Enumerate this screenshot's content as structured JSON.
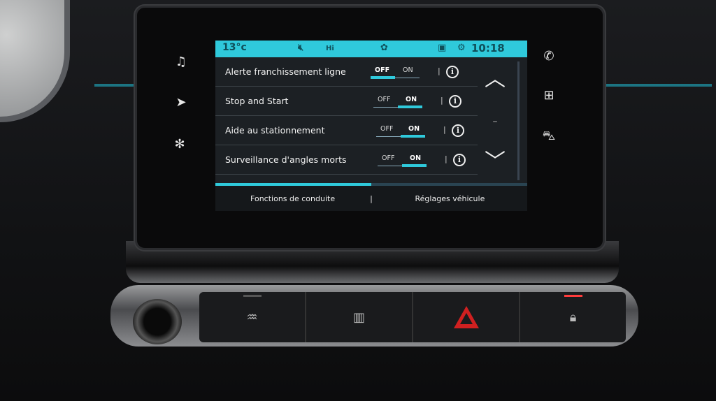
{
  "status_bar": {
    "temperature": "13°c",
    "mute_icon": "speaker-muted-icon",
    "fan_label": "Hi",
    "fan_icon": "fan-icon",
    "screen_icon": "display-icon",
    "settings_icon": "gear-icon",
    "time": "10:18"
  },
  "settings": [
    {
      "label": "Alerte franchissement ligne",
      "off": "OFF",
      "on": "ON",
      "state": "OFF"
    },
    {
      "label": "Stop and Start",
      "off": "OFF",
      "on": "ON",
      "state": "ON"
    },
    {
      "label": "Aide au stationnement",
      "off": "OFF",
      "on": "ON",
      "state": "ON"
    },
    {
      "label": "Surveillance d'angles morts",
      "off": "OFF",
      "on": "ON",
      "state": "ON"
    }
  ],
  "info_glyph": "i",
  "separator": "|",
  "tabs": [
    {
      "label": "Fonctions de conduite",
      "active": true
    },
    {
      "label": "Réglages véhicule",
      "active": false
    }
  ],
  "left_buttons": [
    "music-icon",
    "navigation-icon",
    "climate-fan-icon"
  ],
  "right_buttons": [
    "phone-icon",
    "apps-grid-icon",
    "car-icon"
  ],
  "colors": {
    "accent": "#2fc9db",
    "hazard": "#d02020"
  }
}
